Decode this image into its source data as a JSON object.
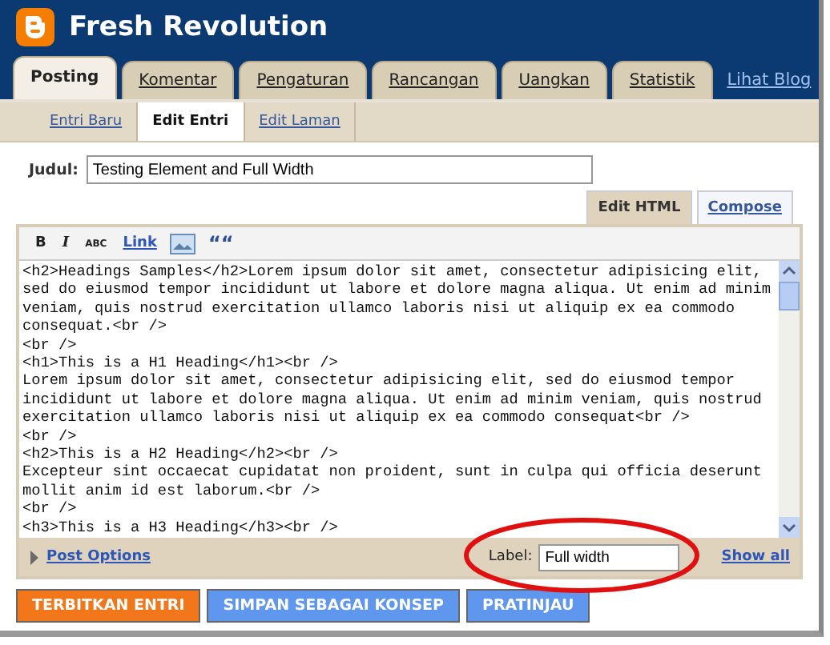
{
  "header": {
    "title": "Fresh Revolution"
  },
  "tabs": [
    {
      "label": "Posting",
      "selected": true
    },
    {
      "label": "Komentar",
      "selected": false
    },
    {
      "label": "Pengaturan",
      "selected": false
    },
    {
      "label": "Rancangan",
      "selected": false
    },
    {
      "label": "Uangkan",
      "selected": false
    },
    {
      "label": "Statistik",
      "selected": false
    }
  ],
  "view_blog_link": "Lihat Blog",
  "subtabs": [
    {
      "label": "Entri Baru",
      "selected": false
    },
    {
      "label": "Edit Entri",
      "selected": true
    },
    {
      "label": "Edit Laman",
      "selected": false
    }
  ],
  "title_field": {
    "label": "Judul:",
    "value": "Testing Element and Full Width"
  },
  "mode_tabs": [
    {
      "label": "Edit HTML",
      "selected": true
    },
    {
      "label": "Compose",
      "selected": false
    }
  ],
  "toolbar": [
    {
      "kind": "bold",
      "label": "B"
    },
    {
      "kind": "italic",
      "label": "I"
    },
    {
      "kind": "spell",
      "label": "ABC"
    },
    {
      "kind": "link",
      "label": "Link"
    },
    {
      "kind": "image"
    },
    {
      "kind": "quote",
      "label": "““"
    }
  ],
  "editor_lines": [
    "<h2>Headings Samples</h2>Lorem ipsum dolor sit amet, consectetur adipisicing elit,",
    "sed do eiusmod tempor incididunt ut labore et dolore magna aliqua. Ut enim ad minim",
    "veniam, quis nostrud exercitation ullamco laboris nisi ut aliquip ex ea commodo",
    "consequat.<br />",
    "<br />",
    "<h1>This is a H1 Heading</h1><br />",
    "Lorem ipsum dolor sit amet, consectetur adipisicing elit, sed do eiusmod tempor",
    "incididunt ut labore et dolore magna aliqua. Ut enim ad minim veniam, quis nostrud",
    "exercitation ullamco laboris nisi ut aliquip ex ea commodo consequat<br />",
    "<br />",
    "<h2>This is a H2 Heading</h2><br />",
    "Excepteur sint occaecat cupidatat non proident, sunt in culpa qui officia deserunt",
    "mollit anim id est laborum.<br />",
    "<br />",
    "<h3>This is a H3 Heading</h3><br />"
  ],
  "post_options": {
    "label": "Post Options",
    "expanded": false
  },
  "labels_field": {
    "label": "Label:",
    "value": "Full width",
    "link": "Show all"
  },
  "buttons": [
    {
      "label": "TERBITKAN ENTRI",
      "kind": "primary"
    },
    {
      "label": "SIMPAN SEBAGAI KONSEP",
      "kind": "secondary"
    },
    {
      "label": "PRATINJAU",
      "kind": "secondary"
    }
  ]
}
